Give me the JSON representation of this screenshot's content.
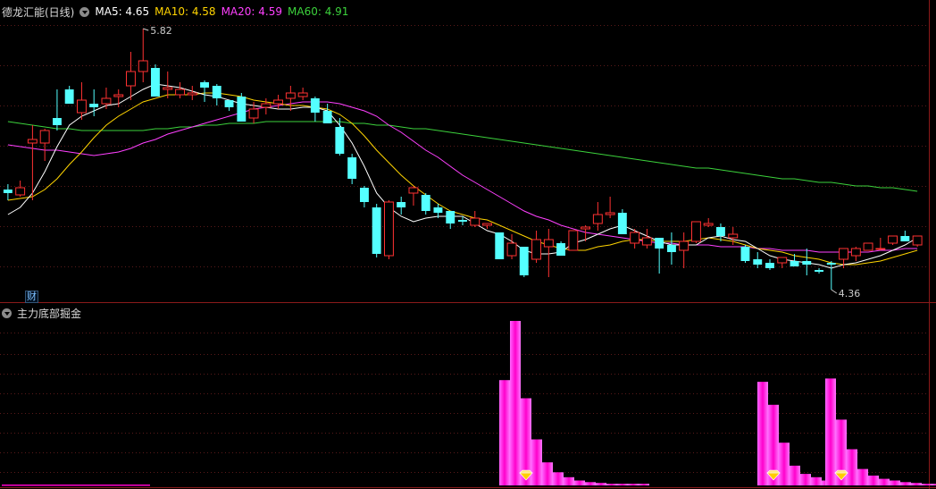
{
  "header": {
    "stock_name": "德龙汇能(日线)",
    "ma_items": [
      {
        "label": "MA5: 4.65",
        "color": "#ffffff"
      },
      {
        "label": "MA10: 4.58",
        "color": "#ffd400"
      },
      {
        "label": "MA20: 4.59",
        "color": "#ff40ff"
      },
      {
        "label": "MA60: 4.91",
        "color": "#3cd23c"
      }
    ],
    "cai_label": "财"
  },
  "sub_header": {
    "indicator_name": "主力底部掘金"
  },
  "chart_data": [
    {
      "type": "candlestick",
      "title": "德龙汇能(日线)",
      "annotations": [
        {
          "text": "5.82",
          "value": 5.82
        },
        {
          "text": "4.36",
          "value": 4.36
        }
      ],
      "ylim": [
        4.3,
        5.88
      ],
      "colors": {
        "up": "#ff3232",
        "down": "#54ffff",
        "ma5": "#ffffff",
        "ma10": "#ffd400",
        "ma20": "#ff40ff",
        "ma60": "#3cd23c"
      },
      "candles": [
        [
          4.92,
          4.95,
          4.86,
          4.9
        ],
        [
          4.89,
          4.97,
          4.88,
          4.93
        ],
        [
          5.18,
          5.28,
          4.86,
          5.2
        ],
        [
          5.18,
          5.26,
          5.08,
          5.25
        ],
        [
          5.32,
          5.48,
          5.25,
          5.28
        ],
        [
          5.48,
          5.5,
          5.4,
          5.4
        ],
        [
          5.35,
          5.52,
          5.31,
          5.42
        ],
        [
          5.4,
          5.48,
          5.33,
          5.38
        ],
        [
          5.4,
          5.49,
          5.37,
          5.43
        ],
        [
          5.44,
          5.48,
          5.38,
          5.45
        ],
        [
          5.5,
          5.69,
          5.42,
          5.58
        ],
        [
          5.58,
          5.82,
          5.52,
          5.64
        ],
        [
          5.6,
          5.62,
          5.48,
          5.44
        ],
        [
          5.48,
          5.58,
          5.43,
          5.49
        ],
        [
          5.45,
          5.52,
          5.43,
          5.48
        ],
        [
          5.45,
          5.5,
          5.42,
          5.46
        ],
        [
          5.52,
          5.53,
          5.41,
          5.49
        ],
        [
          5.5,
          5.51,
          5.39,
          5.43
        ],
        [
          5.42,
          5.42,
          5.36,
          5.38
        ],
        [
          5.44,
          5.46,
          5.3,
          5.3
        ],
        [
          5.32,
          5.41,
          5.29,
          5.37
        ],
        [
          5.38,
          5.43,
          5.34,
          5.4
        ],
        [
          5.4,
          5.45,
          5.37,
          5.42
        ],
        [
          5.43,
          5.5,
          5.36,
          5.46
        ],
        [
          5.44,
          5.49,
          5.42,
          5.46
        ],
        [
          5.43,
          5.44,
          5.3,
          5.35
        ],
        [
          5.36,
          5.4,
          5.3,
          5.29
        ],
        [
          5.27,
          5.32,
          5.11,
          5.12
        ],
        [
          5.1,
          5.12,
          4.95,
          4.98
        ],
        [
          4.93,
          4.94,
          4.82,
          4.85
        ],
        [
          4.82,
          4.84,
          4.54,
          4.56
        ],
        [
          4.55,
          4.86,
          4.53,
          4.85
        ],
        [
          4.85,
          4.88,
          4.78,
          4.82
        ],
        [
          4.9,
          4.94,
          4.83,
          4.93
        ],
        [
          4.89,
          4.9,
          4.78,
          4.8
        ],
        [
          4.82,
          4.84,
          4.76,
          4.79
        ],
        [
          4.8,
          4.8,
          4.7,
          4.73
        ],
        [
          4.75,
          4.77,
          4.72,
          4.74
        ],
        [
          4.72,
          4.8,
          4.71,
          4.76
        ],
        [
          4.72,
          4.73,
          4.7,
          4.73
        ],
        [
          4.68,
          4.68,
          4.59,
          4.53
        ],
        [
          4.55,
          4.67,
          4.53,
          4.62
        ],
        [
          4.6,
          4.6,
          4.43,
          4.44
        ],
        [
          4.53,
          4.69,
          4.51,
          4.64
        ],
        [
          4.6,
          4.7,
          4.43,
          4.64
        ],
        [
          4.62,
          4.63,
          4.56,
          4.55
        ],
        [
          4.58,
          4.67,
          4.58,
          4.69
        ],
        [
          4.7,
          4.72,
          4.63,
          4.71
        ],
        [
          4.73,
          4.85,
          4.69,
          4.78
        ],
        [
          4.78,
          4.88,
          4.76,
          4.79
        ],
        [
          4.79,
          4.81,
          4.68,
          4.67
        ],
        [
          4.62,
          4.7,
          4.59,
          4.68
        ],
        [
          4.61,
          4.7,
          4.59,
          4.65
        ],
        [
          4.65,
          4.62,
          4.45,
          4.59
        ],
        [
          4.61,
          4.68,
          4.5,
          4.57
        ],
        [
          4.58,
          4.68,
          4.48,
          4.63
        ],
        [
          4.63,
          4.74,
          4.62,
          4.74
        ],
        [
          4.72,
          4.76,
          4.71,
          4.73
        ],
        [
          4.71,
          4.73,
          4.63,
          4.66
        ],
        [
          4.65,
          4.71,
          4.61,
          4.67
        ],
        [
          4.6,
          4.61,
          4.51,
          4.52
        ],
        [
          4.53,
          4.57,
          4.48,
          4.5
        ],
        [
          4.51,
          4.53,
          4.47,
          4.48
        ],
        [
          4.51,
          4.54,
          4.48,
          4.54
        ],
        [
          4.52,
          4.56,
          4.49,
          4.49
        ],
        [
          4.52,
          4.59,
          4.44,
          4.5
        ],
        [
          4.47,
          4.48,
          4.45,
          4.46
        ],
        [
          4.51,
          4.52,
          4.36,
          4.5
        ],
        [
          4.53,
          4.53,
          4.48,
          4.59
        ],
        [
          4.55,
          4.6,
          4.52,
          4.59
        ],
        [
          4.58,
          4.62,
          4.58,
          4.62
        ],
        [
          4.59,
          4.65,
          4.58,
          4.59
        ],
        [
          4.62,
          4.65,
          4.61,
          4.66
        ],
        [
          4.66,
          4.69,
          4.64,
          4.63
        ],
        [
          4.61,
          4.66,
          4.6,
          4.66
        ]
      ],
      "ma5": [
        4.78,
        4.82,
        4.9,
        5.02,
        5.16,
        5.28,
        5.33,
        5.36,
        5.39,
        5.4,
        5.44,
        5.48,
        5.51,
        5.5,
        5.49,
        5.47,
        5.45,
        5.44,
        5.42,
        5.4,
        5.39,
        5.38,
        5.37,
        5.37,
        5.38,
        5.38,
        5.36,
        5.28,
        5.18,
        5.05,
        4.9,
        4.82,
        4.77,
        4.74,
        4.76,
        4.77,
        4.77,
        4.77,
        4.73,
        4.69,
        4.67,
        4.63,
        4.58,
        4.56,
        4.56,
        4.57,
        4.62,
        4.64,
        4.67,
        4.7,
        4.72,
        4.69,
        4.66,
        4.63,
        4.61,
        4.61,
        4.61,
        4.65,
        4.66,
        4.64,
        4.63,
        4.59,
        4.55,
        4.53,
        4.52,
        4.51,
        4.5,
        4.48,
        4.5,
        4.51,
        4.53,
        4.55,
        4.58,
        4.61,
        4.65
      ],
      "ma10": [
        4.86,
        4.87,
        4.88,
        4.92,
        4.98,
        5.06,
        5.13,
        5.21,
        5.28,
        5.33,
        5.37,
        5.41,
        5.43,
        5.45,
        5.45,
        5.45,
        5.46,
        5.46,
        5.45,
        5.44,
        5.42,
        5.41,
        5.4,
        5.39,
        5.39,
        5.38,
        5.37,
        5.34,
        5.29,
        5.22,
        5.14,
        5.07,
        5.0,
        4.94,
        4.89,
        4.84,
        4.8,
        4.78,
        4.76,
        4.75,
        4.72,
        4.69,
        4.66,
        4.63,
        4.61,
        4.59,
        4.58,
        4.58,
        4.6,
        4.61,
        4.63,
        4.64,
        4.64,
        4.63,
        4.63,
        4.63,
        4.64,
        4.65,
        4.64,
        4.63,
        4.61,
        4.59,
        4.58,
        4.57,
        4.55,
        4.54,
        4.53,
        4.51,
        4.5,
        4.5,
        4.51,
        4.52,
        4.54,
        4.56,
        4.58
      ],
      "ma20": [
        5.17,
        5.16,
        5.15,
        5.14,
        5.14,
        5.13,
        5.12,
        5.11,
        5.12,
        5.13,
        5.15,
        5.18,
        5.2,
        5.23,
        5.25,
        5.27,
        5.29,
        5.31,
        5.33,
        5.35,
        5.37,
        5.38,
        5.39,
        5.4,
        5.41,
        5.41,
        5.41,
        5.4,
        5.38,
        5.36,
        5.33,
        5.28,
        5.24,
        5.19,
        5.14,
        5.1,
        5.05,
        5.0,
        4.96,
        4.92,
        4.88,
        4.84,
        4.8,
        4.77,
        4.75,
        4.72,
        4.7,
        4.68,
        4.67,
        4.66,
        4.65,
        4.64,
        4.63,
        4.62,
        4.62,
        4.61,
        4.61,
        4.61,
        4.6,
        4.6,
        4.6,
        4.59,
        4.59,
        4.58,
        4.58,
        4.58,
        4.57,
        4.57,
        4.57,
        4.57,
        4.57,
        4.58,
        4.58,
        4.59,
        4.59
      ],
      "ma60": [
        5.3,
        5.29,
        5.28,
        5.27,
        5.26,
        5.26,
        5.25,
        5.25,
        5.25,
        5.25,
        5.25,
        5.25,
        5.26,
        5.26,
        5.27,
        5.27,
        5.28,
        5.28,
        5.29,
        5.29,
        5.29,
        5.3,
        5.3,
        5.3,
        5.3,
        5.3,
        5.3,
        5.3,
        5.29,
        5.29,
        5.28,
        5.28,
        5.27,
        5.26,
        5.26,
        5.25,
        5.24,
        5.23,
        5.22,
        5.21,
        5.2,
        5.19,
        5.18,
        5.17,
        5.16,
        5.15,
        5.14,
        5.13,
        5.12,
        5.11,
        5.1,
        5.09,
        5.08,
        5.07,
        5.06,
        5.05,
        5.04,
        5.04,
        5.03,
        5.02,
        5.01,
        5.0,
        4.99,
        4.98,
        4.98,
        4.97,
        4.96,
        4.96,
        4.95,
        4.94,
        4.94,
        4.93,
        4.93,
        4.92,
        4.91
      ]
    },
    {
      "type": "bar",
      "title": "主力底部掘金",
      "values": [
        0.02,
        0.02,
        0.02,
        0.02,
        0.02,
        0.02,
        0.02,
        0.02,
        0.02,
        0.02,
        0.02,
        0.02,
        0.02,
        0.02,
        0,
        0,
        0,
        0,
        0,
        0,
        0,
        0,
        0,
        0,
        0,
        0,
        0,
        0,
        0,
        0,
        0,
        0,
        0,
        0,
        0,
        0,
        0,
        0,
        0,
        0,
        0,
        0,
        0,
        0,
        0,
        0,
        0,
        0,
        0,
        0,
        0,
        0,
        0,
        0,
        0,
        0,
        0,
        0,
        0,
        0,
        0,
        0,
        0,
        0,
        0,
        0,
        0,
        0,
        0,
        0,
        0,
        0,
        0,
        0,
        0,
        0,
        0,
        0,
        0,
        0,
        0,
        0,
        0,
        0,
        0,
        0,
        0,
        0,
        0,
        0,
        0,
        0,
        0,
        0,
        0,
        0,
        0,
        0,
        0,
        0,
        0,
        0,
        0,
        0,
        0,
        0,
        0,
        0,
        0,
        0,
        0,
        0,
        0,
        0,
        0,
        0,
        0,
        0,
        0,
        0,
        0,
        0,
        0,
        0,
        0,
        0,
        0,
        0,
        0,
        0,
        0,
        0,
        0,
        0,
        0,
        0,
        0,
        0,
        0,
        0,
        0,
        0,
        0,
        0,
        0,
        0,
        0,
        0,
        0,
        0,
        0,
        0,
        0,
        0,
        0,
        0,
        0,
        0,
        0,
        0,
        0,
        0,
        0,
        0,
        0,
        0,
        0,
        0,
        0,
        0,
        0,
        0,
        0,
        0,
        0,
        0,
        0,
        0,
        0,
        0,
        0,
        0,
        0,
        0,
        0,
        0,
        0,
        0,
        0,
        0,
        0,
        0,
        0,
        0,
        0,
        0,
        0,
        0,
        0,
        0,
        0,
        0,
        0,
        0,
        0,
        0,
        0,
        0,
        0,
        0,
        0,
        0,
        0,
        0,
        0,
        0,
        0,
        0,
        0,
        0,
        0,
        0,
        0,
        0,
        0,
        0,
        0,
        0,
        0,
        0,
        0,
        0,
        0,
        0,
        0,
        0,
        0,
        0,
        0,
        0,
        0,
        0,
        0,
        0,
        0,
        0,
        0,
        0,
        0,
        0,
        0,
        0,
        0,
        0,
        0,
        0,
        0,
        0,
        0,
        0,
        0,
        0,
        0,
        0,
        0,
        0,
        0,
        0,
        0,
        0,
        0,
        0,
        0,
        0,
        0,
        0,
        0,
        0,
        0,
        0,
        0,
        0,
        0,
        0,
        0,
        0,
        0,
        0,
        0
      ],
      "bar_groups": [
        {
          "values": [
            0.64,
            1.0,
            0.53,
            0.28,
            0.14,
            0.08,
            0.05,
            0.03,
            0.02,
            0.015,
            0.01,
            0.01,
            0.01,
            0.01
          ],
          "gem_index": 2
        },
        {
          "values": [
            0.63,
            0.49,
            0.26,
            0.12,
            0.07,
            0.05,
            0.03
          ],
          "gem_index": 1
        },
        {
          "values": [
            0.65,
            0.4,
            0.22,
            0.1,
            0.06,
            0.04,
            0.03,
            0.02,
            0.015,
            0.01,
            0.01
          ],
          "gem_index": 1
        }
      ],
      "colors": {
        "bar": "#ff00cc",
        "gem": "#ffcc00"
      }
    }
  ]
}
